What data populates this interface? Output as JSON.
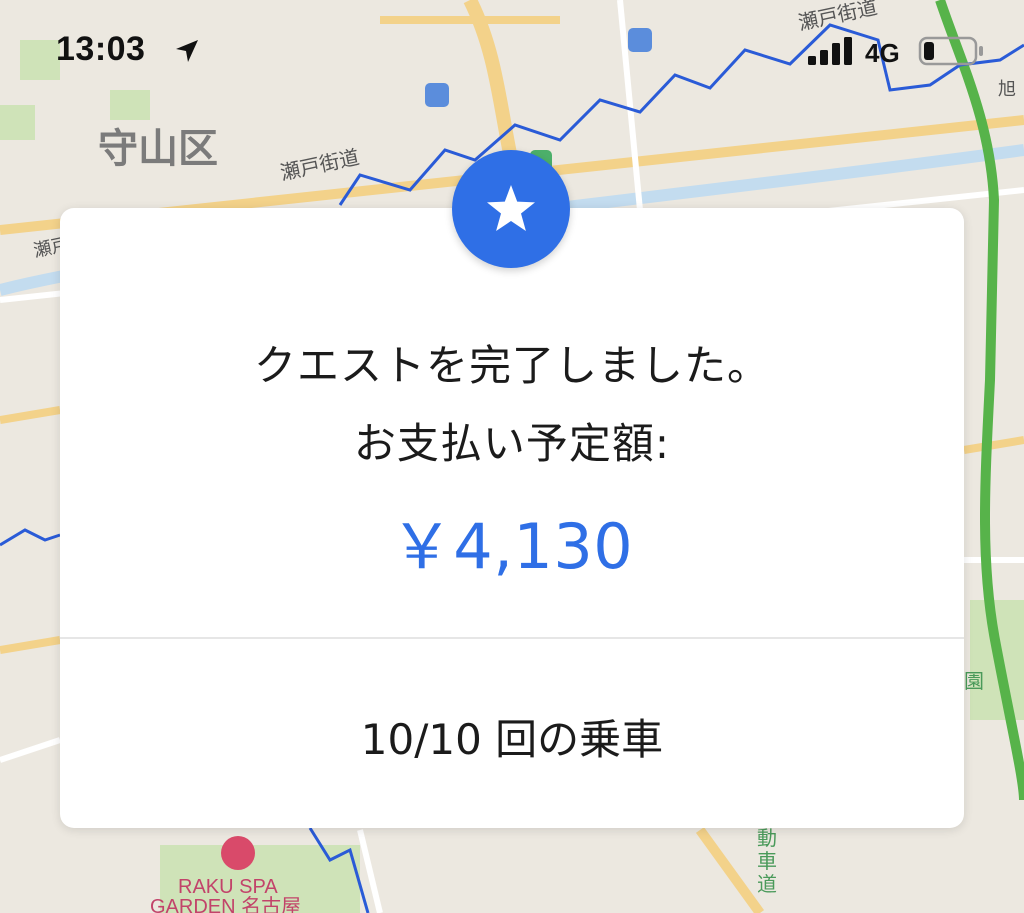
{
  "status_bar": {
    "time": "13:03",
    "network": "4G"
  },
  "map": {
    "labels": {
      "district": "守山区",
      "seto_kaido": "瀬戸街道",
      "seto_kaido_2": "瀬戸街道",
      "seto_left": "瀬戸",
      "asahi": "旭",
      "spa_1": "RAKU SPA",
      "spa_2": "GARDEN 名古屋",
      "road_1": "動",
      "road_2": "車",
      "road_3": "道",
      "park": "園"
    }
  },
  "dialog": {
    "badge_icon": "star-icon",
    "message_line1": "クエストを完了しました。",
    "message_line2": "お支払い予定額:",
    "amount": "￥4,130",
    "rides": "10/10 回の乗車"
  },
  "colors": {
    "accent": "#2f6fe6",
    "map_background": "#ece8e0",
    "route_blue": "#2a5bd7",
    "route_green": "#57b34a"
  }
}
